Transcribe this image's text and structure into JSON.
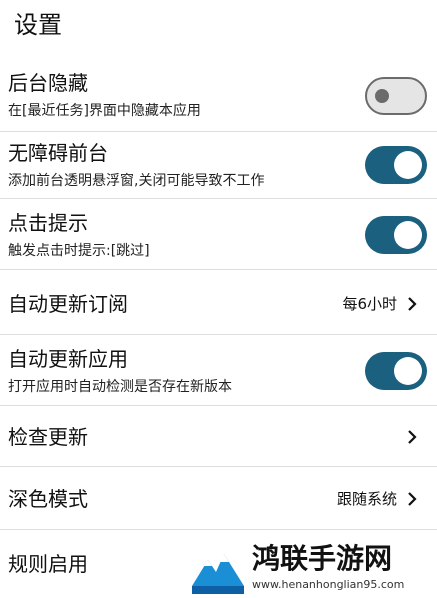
{
  "header": {
    "title": "设置"
  },
  "settings": {
    "hide_background": {
      "label": "后台隐藏",
      "description": "在[最近任务]界面中隐藏本应用",
      "enabled": false
    },
    "accessibility": {
      "label": "无障碍前台",
      "description": "添加前台透明悬浮窗,关闭可能导致不工作",
      "enabled": true
    },
    "click_hint": {
      "label": "点击提示",
      "description": "触发点击时提示:[跳过]",
      "enabled": true
    },
    "auto_update_subscription": {
      "label": "自动更新订阅",
      "value": "每6小时"
    },
    "auto_update_app": {
      "label": "自动更新应用",
      "description": "打开应用时自动检测是否存在新版本",
      "enabled": true
    },
    "check_update": {
      "label": "检查更新"
    },
    "dark_mode": {
      "label": "深色模式",
      "value": "跟随系统"
    },
    "rules_enabled": {
      "label": "规则启用"
    }
  },
  "watermark": {
    "name": "鸿联手游网",
    "url": "www.henanhonglian95.com"
  },
  "colors": {
    "toggle_on": "#1b607e",
    "toggle_off": "#e5e5e5"
  }
}
